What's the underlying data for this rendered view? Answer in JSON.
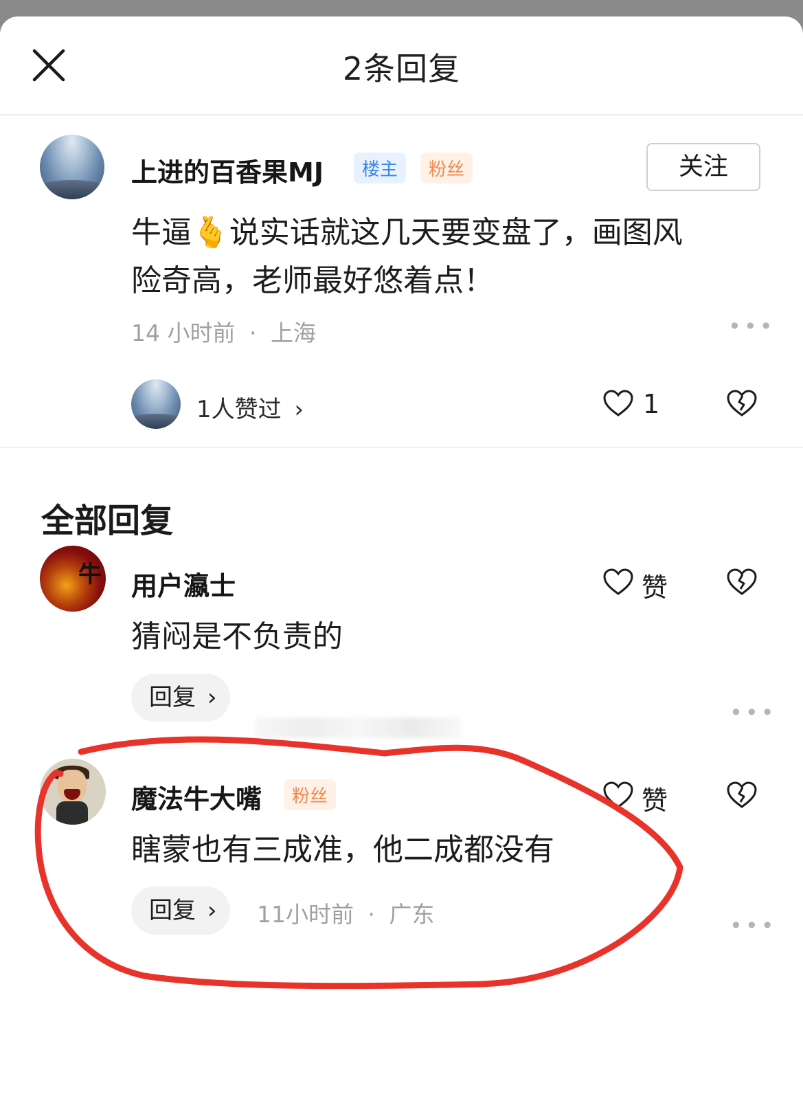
{
  "header": {
    "title": "2条回复"
  },
  "main_comment": {
    "username": "上进的百香果MJ",
    "badges": [
      "楼主",
      "粉丝"
    ],
    "follow_label": "关注",
    "text_line1": "牛逼🫰说实话就这几天要变盘了，画图风",
    "text_line2": "险奇高，老师最好悠着点！",
    "time": "14 小时前",
    "location": "上海",
    "likers_text": "1人赞过",
    "like_count": "1"
  },
  "section": {
    "title": "全部回复"
  },
  "replies": [
    {
      "username": "用户瀛士",
      "text": "猜闷是不负责的",
      "like_label": "赞",
      "reply_label": "回复"
    },
    {
      "username": "魔法牛大嘴",
      "badge": "粉丝",
      "text": "瞎蒙也有三成准，他二成都没有",
      "like_label": "赞",
      "reply_label": "回复",
      "time": "11小时前",
      "location": "广东"
    }
  ],
  "separator": "·",
  "annotation_color": "#e8332b"
}
